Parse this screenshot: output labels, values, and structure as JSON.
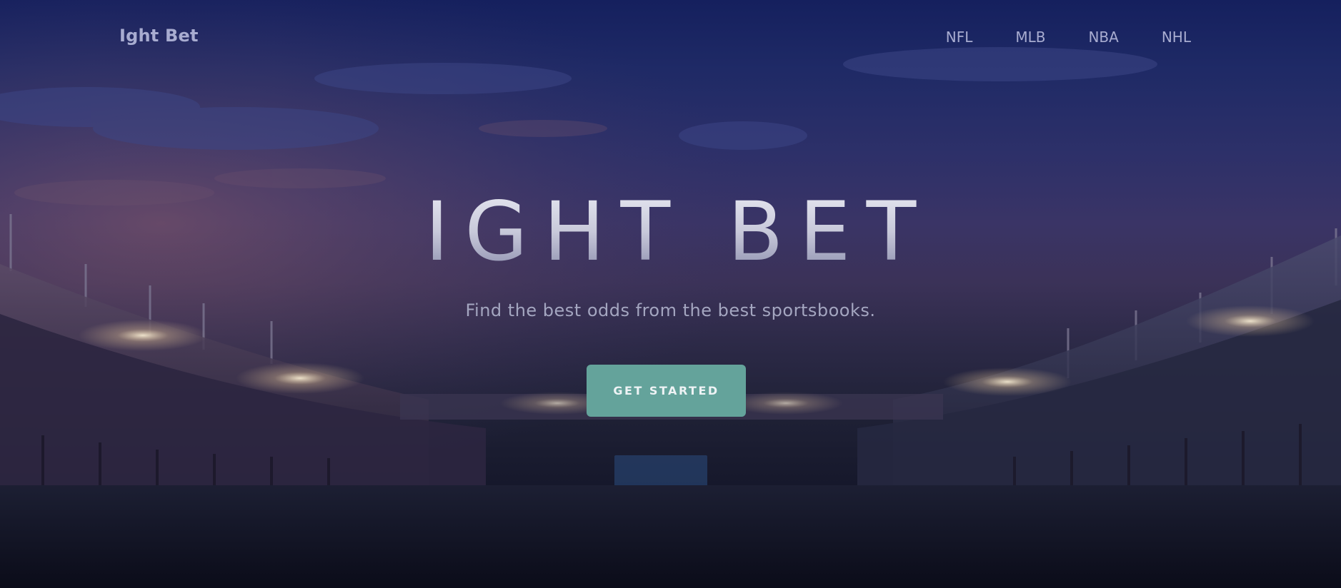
{
  "nav": {
    "brand": "Ight Bet",
    "links": [
      {
        "label": "NFL"
      },
      {
        "label": "MLB"
      },
      {
        "label": "NBA"
      },
      {
        "label": "NHL"
      }
    ]
  },
  "hero": {
    "title": "IGHT BET",
    "subtitle": "Find the best odds from the best sportsbooks.",
    "cta_label": "GET STARTED"
  },
  "colors": {
    "accent": "#64a39b",
    "nav_text": "#a8acd0",
    "background_top": "#15205e",
    "background_bottom": "#0c0d1b"
  }
}
